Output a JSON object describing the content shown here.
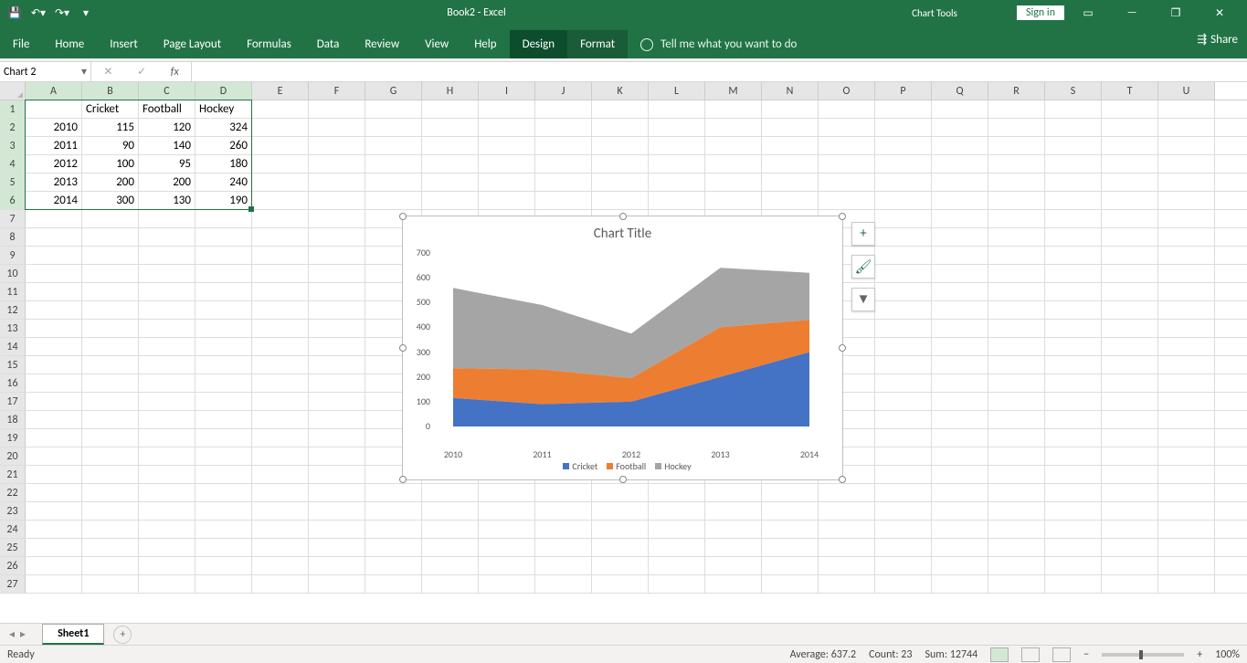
{
  "app": {
    "title": "Book2 - Excel",
    "chart_tools": "Chart Tools",
    "signin": "Sign in"
  },
  "tabs": {
    "file": "File",
    "home": "Home",
    "insert": "Insert",
    "page_layout": "Page Layout",
    "formulas": "Formulas",
    "data": "Data",
    "review": "Review",
    "view": "View",
    "help": "Help",
    "design": "Design",
    "format": "Format",
    "tell_me": "Tell me what you want to do",
    "share": "Share"
  },
  "formula_bar": {
    "name_box": "Chart 2",
    "fx": "fx"
  },
  "columns": [
    "A",
    "B",
    "C",
    "D",
    "E",
    "F",
    "G",
    "H",
    "I",
    "J",
    "K",
    "L",
    "M",
    "N",
    "O",
    "P",
    "Q",
    "R",
    "S",
    "T",
    "U"
  ],
  "row_numbers": [
    1,
    2,
    3,
    4,
    5,
    6,
    7,
    8,
    9,
    10,
    11,
    12,
    13,
    14,
    15,
    16,
    17,
    18,
    19,
    20,
    21,
    22,
    23,
    24,
    25,
    26,
    27
  ],
  "sheet_data": {
    "headers": {
      "B1": "Cricket",
      "C1": "Football",
      "D1": "Hockey"
    },
    "rows": [
      {
        "A": "2010",
        "B": "115",
        "C": "120",
        "D": "324"
      },
      {
        "A": "2011",
        "B": "90",
        "C": "140",
        "D": "260"
      },
      {
        "A": "2012",
        "B": "100",
        "C": "95",
        "D": "180"
      },
      {
        "A": "2013",
        "B": "200",
        "C": "200",
        "D": "240"
      },
      {
        "A": "2014",
        "B": "300",
        "C": "130",
        "D": "190"
      }
    ]
  },
  "chart_data": {
    "type": "area",
    "stacked": true,
    "title": "Chart Title",
    "xlabel": "",
    "ylabel": "",
    "categories": [
      "2010",
      "2011",
      "2012",
      "2013",
      "2014"
    ],
    "series": [
      {
        "name": "Cricket",
        "values": [
          115,
          90,
          100,
          200,
          300
        ],
        "color": "#4472C4"
      },
      {
        "name": "Football",
        "values": [
          120,
          140,
          95,
          200,
          130
        ],
        "color": "#ED7D31"
      },
      {
        "name": "Hockey",
        "values": [
          324,
          260,
          180,
          240,
          190
        ],
        "color": "#A5A5A5"
      }
    ],
    "ylim": [
      0,
      700
    ],
    "yticks": [
      0,
      100,
      200,
      300,
      400,
      500,
      600,
      700
    ]
  },
  "sheets": {
    "active": "Sheet1"
  },
  "status": {
    "ready": "Ready",
    "average_label": "Average:",
    "average": "637.2",
    "count_label": "Count:",
    "count": "23",
    "sum_label": "Sum:",
    "sum": "12744",
    "zoom": "100%"
  }
}
